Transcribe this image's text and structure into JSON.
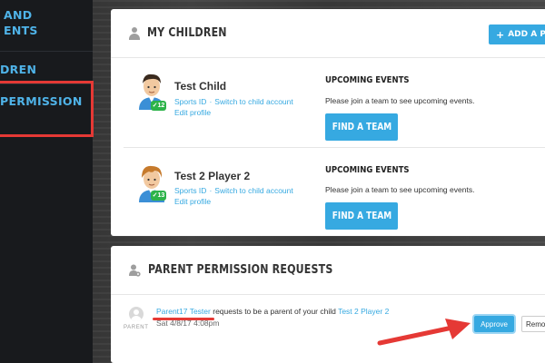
{
  "sidebar": {
    "items": [
      {
        "label_line1": "AND",
        "label_line2": "ENTS"
      },
      {
        "label": "DREN"
      },
      {
        "label_line1": "PERMISSION",
        "label_line2": ""
      }
    ]
  },
  "children_card": {
    "title": "MY CHILDREN",
    "add_button": "ADD A PLAYER",
    "children": [
      {
        "name": "Test Child",
        "badge": "12",
        "sports_id": "Sports ID",
        "switch_link": "Switch to child account",
        "edit_profile": "Edit profile",
        "upcoming_title": "UPCOMING EVENTS",
        "upcoming_text": "Please join a team to see upcoming events.",
        "find_button": "FIND A TEAM"
      },
      {
        "name": "Test 2 Player 2",
        "badge": "13",
        "sports_id": "Sports ID",
        "switch_link": "Switch to child account",
        "edit_profile": "Edit profile",
        "upcoming_title": "UPCOMING EVENTS",
        "upcoming_text": "Please join a team to see upcoming events.",
        "find_button": "FIND A TEAM"
      }
    ]
  },
  "requests_card": {
    "title": "PARENT PERMISSION REQUESTS",
    "request": {
      "requester": "Parent17 Tester",
      "text_middle": "requests to be a parent of your child",
      "child": "Test 2 Player 2",
      "date": "Sat 4/8/17 4:08pm",
      "role": "PARENT",
      "approve": "Approve",
      "remove": "Remove"
    }
  },
  "colors": {
    "accent": "#36a9e1",
    "sidebar_text": "#4fb3e8",
    "highlight": "#e53935",
    "badge_green": "#2db34a"
  },
  "icons": {
    "children_header": "person-icon",
    "requests_header": "person-gear-icon",
    "add": "plus-icon",
    "badge": "check-icon"
  }
}
